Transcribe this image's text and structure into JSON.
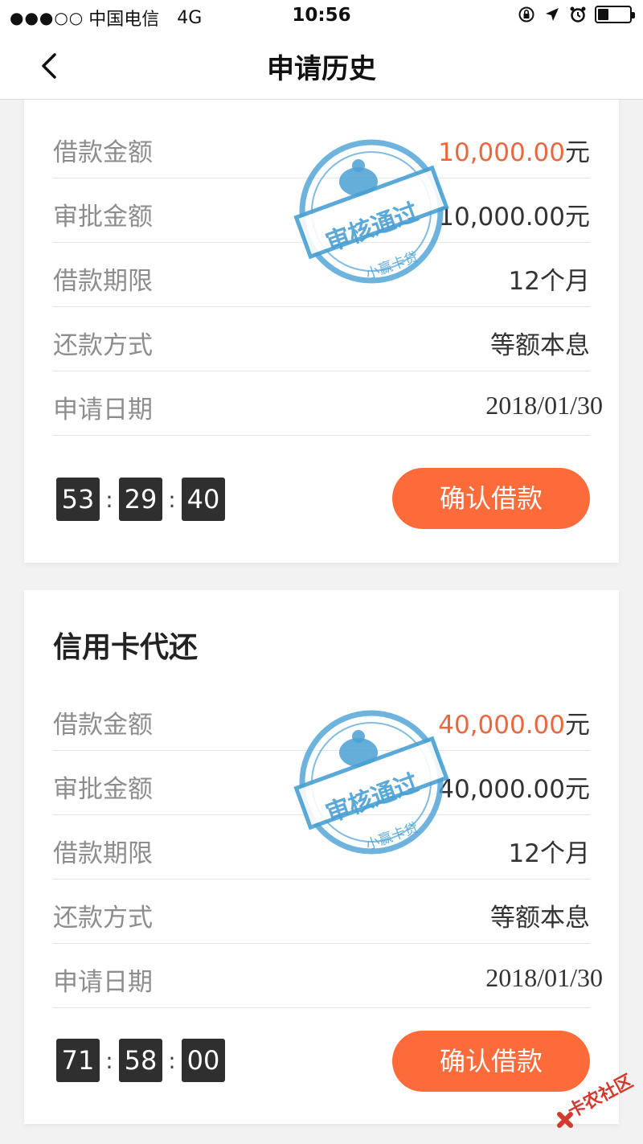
{
  "status_bar": {
    "signal": "●●●○○",
    "carrier": "中国电信",
    "network": "4G",
    "time": "10:56",
    "battery_level": 0.35
  },
  "nav": {
    "back_icon": "chevron-left-icon",
    "title": "申请历史"
  },
  "applications": [
    {
      "title": "",
      "rows": [
        {
          "label": "借款金额",
          "value": "10,000.00",
          "suffix": "元"
        },
        {
          "label": "审批金额",
          "value": "10,000.00元"
        },
        {
          "label": "借款期限",
          "value": "12个月"
        },
        {
          "label": "还款方式",
          "value": "等额本息"
        },
        {
          "label": "申请日期",
          "value": "2018/01/30"
        }
      ],
      "timer": {
        "h": "53",
        "m": "29",
        "s": "40",
        "sep": ":"
      },
      "confirm_button": "确认借款",
      "stamp": {
        "text": "审核通过",
        "sub": "小赢卡贷"
      }
    },
    {
      "title": "信用卡代还",
      "rows": [
        {
          "label": "借款金额",
          "value": "40,000.00",
          "suffix": "元"
        },
        {
          "label": "审批金额",
          "value": "40,000.00元"
        },
        {
          "label": "借款期限",
          "value": "12个月"
        },
        {
          "label": "还款方式",
          "value": "等额本息"
        },
        {
          "label": "申请日期",
          "value": "2018/01/30"
        }
      ],
      "timer": {
        "h": "71",
        "m": "58",
        "s": "00",
        "sep": ":"
      },
      "confirm_button": "确认借款",
      "stamp": {
        "text": "审核通过",
        "sub": "小赢卡贷"
      }
    }
  ],
  "watermark": {
    "text": "卡农社区"
  },
  "colors": {
    "accent": "#fe6b3a",
    "amount_highlight": "#e8693f",
    "stamp_blue": "#4aa0d4",
    "timer_bg": "#2f2f2f"
  }
}
